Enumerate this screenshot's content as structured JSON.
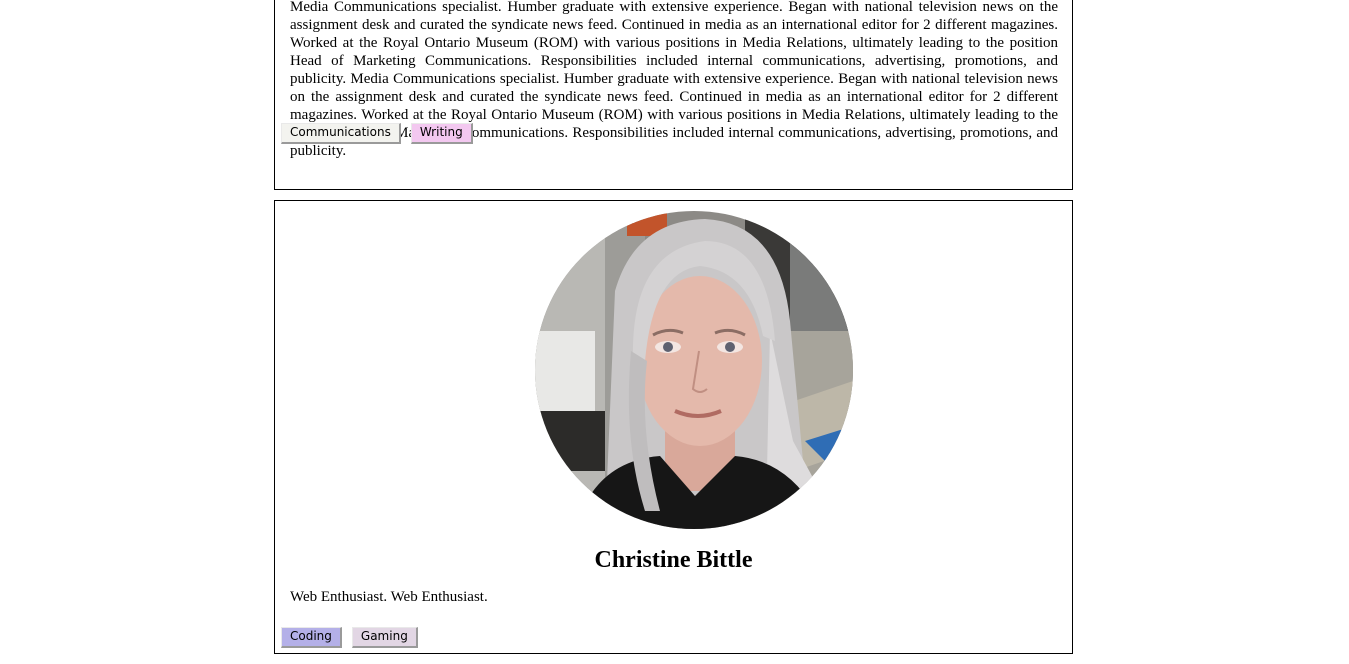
{
  "profiles": [
    {
      "bio": "Media Communications specialist. Humber graduate with extensive experience. Began with national television news on the assignment desk and curated the syndicate news feed. Continued in media as an international editor for 2 different magazines. Worked at the Royal Ontario Museum (ROM) with various positions in Media Relations, ultimately leading to the position Head of Marketing Communications. Responsibilities included internal communications, advertising, promotions, and publicity. Media Communications specialist. Humber graduate with extensive experience. Began with national television news on the assignment desk and curated the syndicate news feed. Continued in media as an international editor for 2 different magazines. Worked at the Royal Ontario Museum (ROM) with various positions in Media Relations, ultimately leading to the position Head of Marketing Communications. Responsibilities included internal communications, advertising, promotions, and publicity.",
      "tags": [
        {
          "label": "Communications",
          "color": "#f3f3ef"
        },
        {
          "label": "Writing",
          "color": "#f3c8f0"
        }
      ]
    },
    {
      "name": "Christine Bittle",
      "bio": "Web Enthusiast. Web Enthusiast.",
      "tags": [
        {
          "label": "Coding",
          "color": "#b4b0e8"
        },
        {
          "label": "Gaming",
          "color": "#e2d6e4"
        }
      ]
    }
  ]
}
